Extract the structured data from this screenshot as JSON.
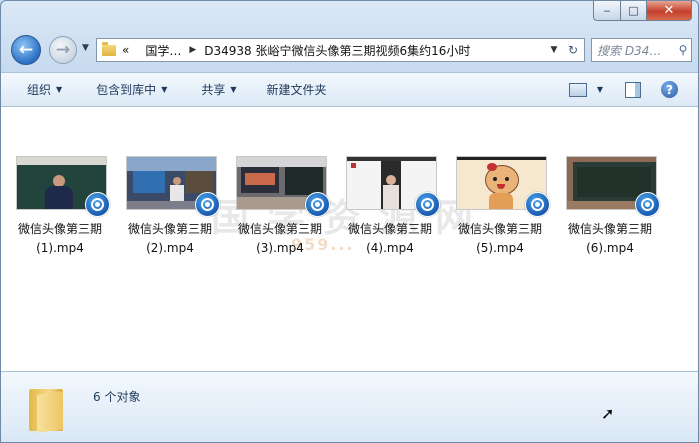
{
  "window": {
    "caption": {
      "minimize": "‒",
      "maximize": "□",
      "close": "✕"
    }
  },
  "nav": {
    "back_glyph": "←",
    "forward_glyph": "→",
    "history_glyph": "▼",
    "breadcrumb": [
      "«",
      "国学…",
      "D34938 张峪宁微信头像第三期视频6集约16小时"
    ],
    "separator": "▶",
    "refresh_glyph": "↻",
    "search_placeholder": "搜索 D34…"
  },
  "toolbar": {
    "organize": "组织",
    "include_library": "包含到库中",
    "share": "共享",
    "new_folder": "新建文件夹",
    "help": "?"
  },
  "files": [
    {
      "line1": "微信头像第三期",
      "line2": "(1).mp4",
      "thumb": "man-blackboard"
    },
    {
      "line1": "微信头像第三期",
      "line2": "(2).mp4",
      "thumb": "woman-studio"
    },
    {
      "line1": "微信头像第三期",
      "line2": "(3).mp4",
      "thumb": "room-screen"
    },
    {
      "line1": "微信头像第三期",
      "line2": "(4).mp4",
      "thumb": "video-call"
    },
    {
      "line1": "微信头像第三期",
      "line2": "(5).mp4",
      "thumb": "cartoon-cat"
    },
    {
      "line1": "微信头像第三期",
      "line2": "(6).mp4",
      "thumb": "blackboard"
    }
  ],
  "watermark": {
    "text": "国学资源网",
    "sub": "959..."
  },
  "details": {
    "count": "6 个对象"
  },
  "colors": {
    "accent": "#1e395b",
    "selection": "#c4d8ee",
    "video_icon": "#1a5bb0"
  }
}
